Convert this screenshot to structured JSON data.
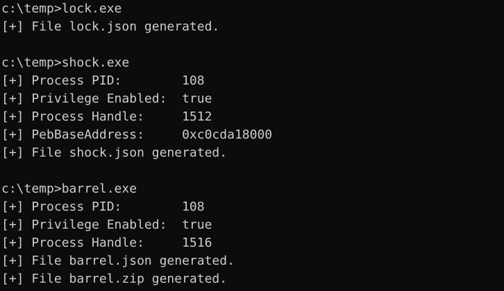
{
  "console": {
    "lines": [
      "c:\\temp>lock.exe",
      "[+] File lock.json generated.",
      "",
      "c:\\temp>shock.exe",
      "[+] Process PID:        108",
      "[+] Privilege Enabled:  true",
      "[+] Process Handle:     1512",
      "[+] PebBaseAddress:     0xc0cda18000",
      "[+] File shock.json generated.",
      "",
      "c:\\temp>barrel.exe",
      "[+] Process PID:        108",
      "[+] Privilege Enabled:  true",
      "[+] Process Handle:     1516",
      "[+] File barrel.json generated.",
      "[+] File barrel.zip generated."
    ]
  },
  "colors": {
    "background": "#0c0c0c",
    "foreground": "#cccccc"
  }
}
